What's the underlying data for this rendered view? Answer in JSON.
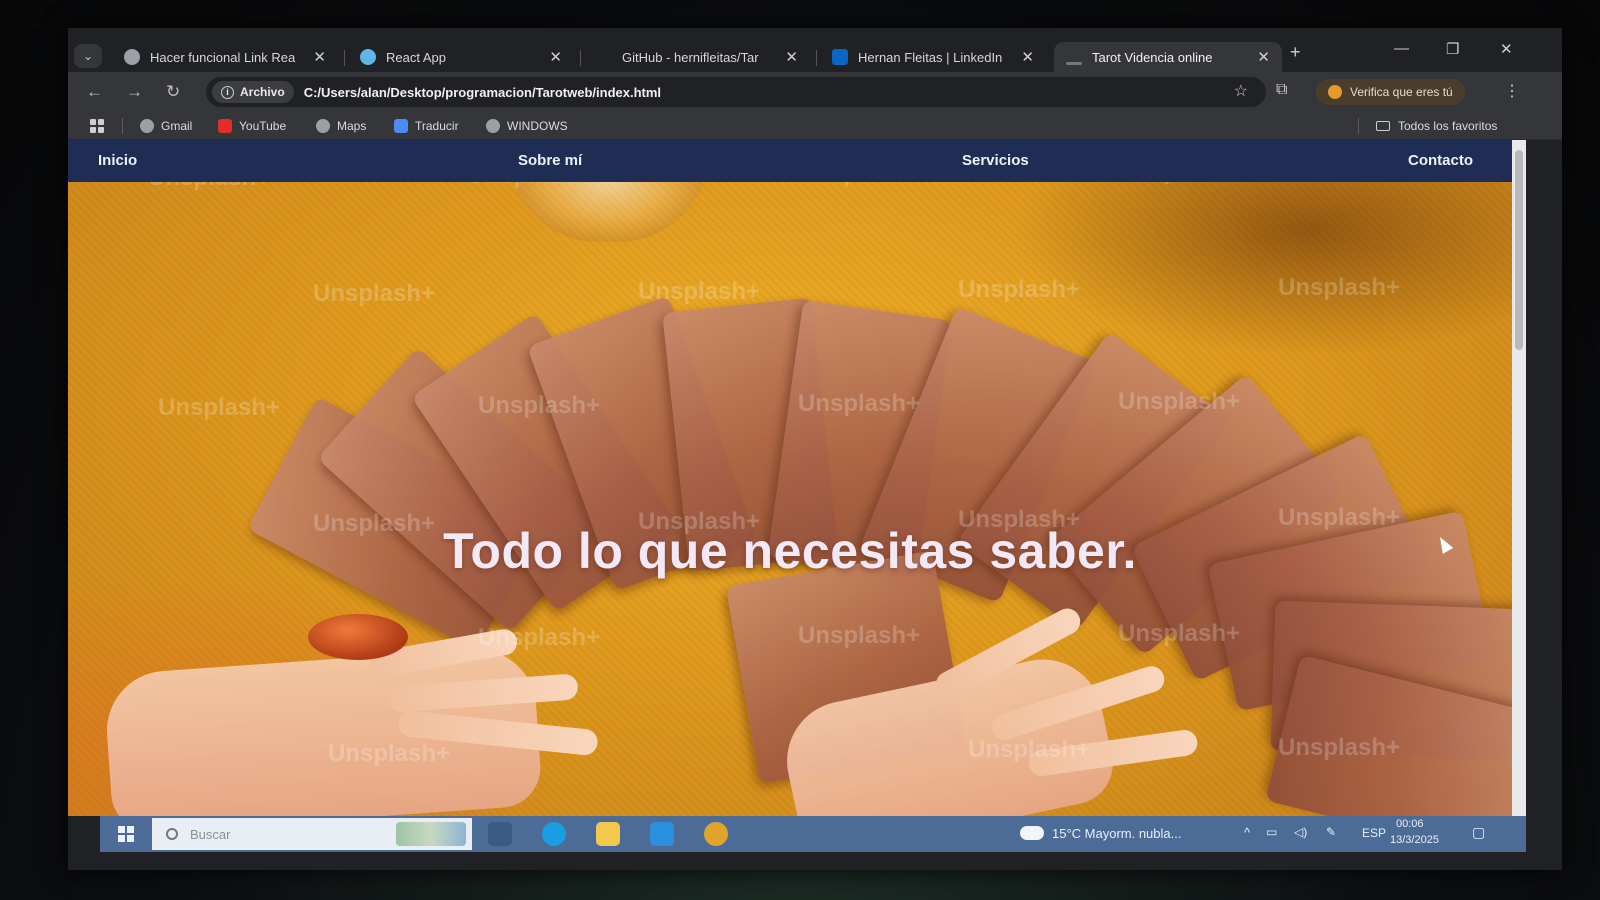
{
  "browser": {
    "tabs": [
      {
        "title": "Hacer funcional Link Rea",
        "favicon_color": "#9aa0a6",
        "active": false
      },
      {
        "title": "React App",
        "favicon_color": "#5fb4e8",
        "active": false
      },
      {
        "title": "GitHub - hernifleitas/Tar",
        "favicon_color": "#202124",
        "active": false
      },
      {
        "title": "Hernan Fleitas | LinkedIn",
        "favicon_color": "#0a66c2",
        "active": false
      },
      {
        "title": "Tarot Videncia online",
        "favicon_color": "#777777",
        "active": true
      }
    ],
    "tab_close_glyph": "✕",
    "new_tab_glyph": "+",
    "address": {
      "chip_label": "Archivo",
      "url": "C:/Users/alan/Desktop/programacion/Tarotweb/index.html"
    },
    "profile_prompt": "Verifica que eres tú",
    "bookmarks": [
      {
        "label": "Gmail",
        "icon": "globe-icon",
        "color": "#9aa0a6"
      },
      {
        "label": "YouTube",
        "icon": "youtube-icon",
        "color": "#e52d27"
      },
      {
        "label": "Maps",
        "icon": "globe-icon",
        "color": "#9aa0a6"
      },
      {
        "label": "Traducir",
        "icon": "translate-icon",
        "color": "#4b8bf5"
      },
      {
        "label": "WINDOWS",
        "icon": "globe-icon",
        "color": "#9aa0a6"
      }
    ],
    "all_bookmarks_label": "Todos los favoritos"
  },
  "site": {
    "nav": {
      "home": "Inicio",
      "about": "Sobre mí",
      "services": "Servicios",
      "contact": "Contacto"
    },
    "hero_title": "Todo lo que necesitas saber.",
    "watermark_text": "Unsplash+",
    "colors": {
      "nav_bg": "#1f2d55",
      "hero_bg": "#e3a123"
    }
  },
  "taskbar": {
    "search_placeholder": "Buscar",
    "weather": "15°C  Mayorm. nubla...",
    "language": "ESP",
    "time": "00:06",
    "date": "13/3/2025",
    "pinned": [
      {
        "name": "task-view-icon",
        "color": "#3b5a86"
      },
      {
        "name": "edge-icon",
        "color": "#1b9de2"
      },
      {
        "name": "file-explorer-icon",
        "color": "#f2c94c"
      },
      {
        "name": "vscode-icon",
        "color": "#2b8fe0"
      },
      {
        "name": "chrome-icon",
        "color": "#e0a52a"
      }
    ]
  }
}
